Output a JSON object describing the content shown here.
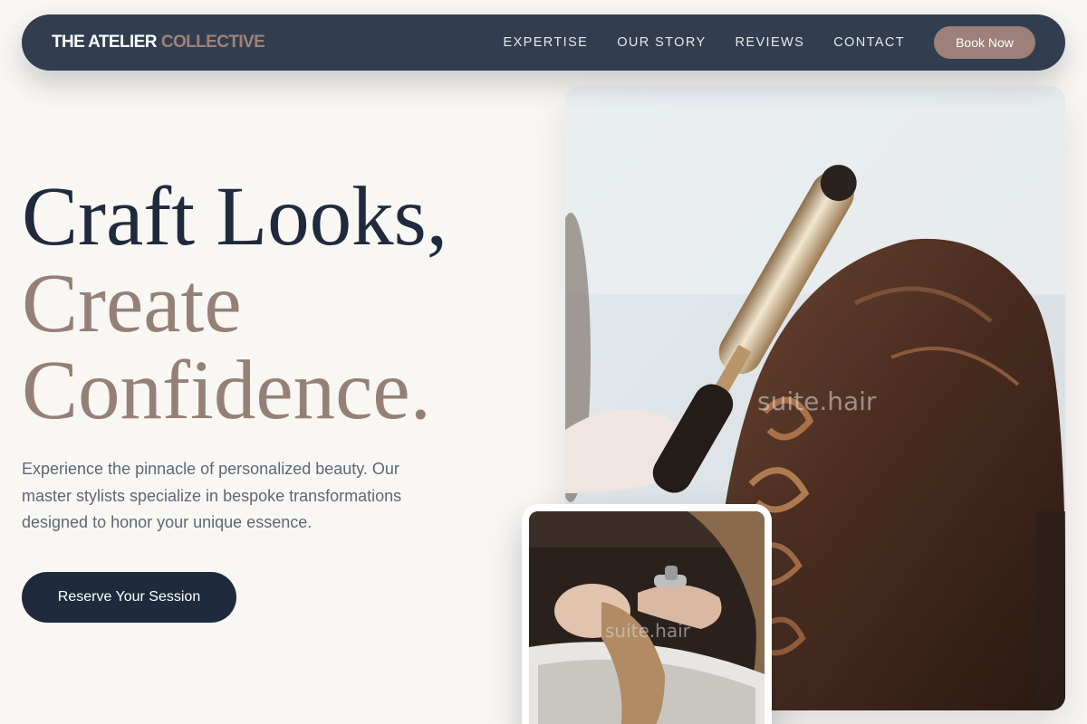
{
  "nav": {
    "brand_primary": "THE ATELIER",
    "brand_accent": "COLLECTIVE",
    "links": [
      "EXPERTISE",
      "OUR STORY",
      "REVIEWS",
      "CONTACT"
    ],
    "cta_label": "Book Now"
  },
  "hero": {
    "title_line1": "Craft Looks,",
    "title_line2": "Create",
    "title_line3": "Confidence.",
    "description": "Experience the pinnacle of personalized beauty. Our master stylists specialize in bespoke transformations designed to honor your unique essence.",
    "cta_label": "Reserve Your Session"
  },
  "images": {
    "main_watermark": "suite.hair",
    "inset_watermark": "suite.hair"
  },
  "colors": {
    "background": "#f9f7f4",
    "nav_bg": "#323e4f",
    "brand_accent": "#9f8279",
    "headline_dark": "#1f2a3d",
    "headline_accent": "#958077",
    "button_dark": "#1f2a3d",
    "button_book": "#9c8079"
  }
}
